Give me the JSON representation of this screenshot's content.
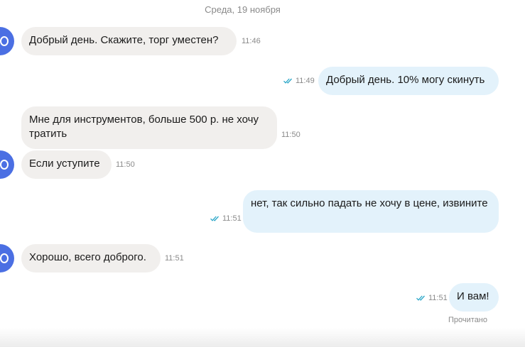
{
  "date_divider": "Среда, 19 ноября",
  "messages": [
    {
      "text": "Добрый день.  Скажите, торг уместен?",
      "time": "11:46",
      "direction": "in"
    },
    {
      "text": "Добрый день. 10% могу скинуть",
      "time": "11:49",
      "direction": "out"
    },
    {
      "text": "Мне для инструментов, больше 500 р. не хочу тратить",
      "time": "11:50",
      "direction": "in"
    },
    {
      "text": "Если уступите",
      "time": "11:50",
      "direction": "in"
    },
    {
      "text": "нет, так сильно падать не хочу в цене, извините",
      "time": "11:51",
      "direction": "out"
    },
    {
      "text": "Хорошо, всего доброго.",
      "time": "11:51",
      "direction": "in"
    },
    {
      "text": "И вам!",
      "time": "11:51",
      "direction": "out"
    }
  ],
  "read_status": "Прочитано",
  "colors": {
    "avatar": "#4b6fe3",
    "incoming_bubble": "#f1efed",
    "outgoing_bubble": "#e3f2fb",
    "read_check": "#2aa6c8"
  }
}
